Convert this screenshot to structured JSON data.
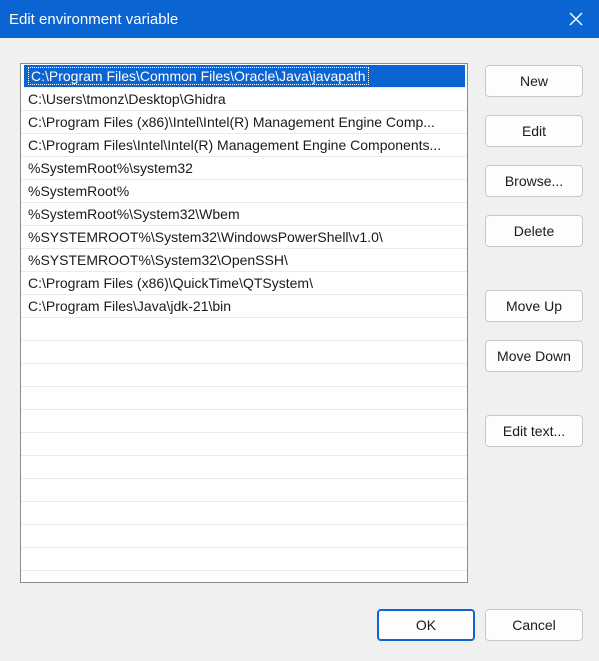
{
  "window": {
    "title": "Edit environment variable",
    "close_icon": "close-icon"
  },
  "paths": [
    "C:\\Program Files\\Common Files\\Oracle\\Java\\javapath",
    "C:\\Users\\tmonz\\Desktop\\Ghidra",
    "C:\\Program Files (x86)\\Intel\\Intel(R) Management Engine Comp...",
    "C:\\Program Files\\Intel\\Intel(R) Management Engine Components...",
    "%SystemRoot%\\system32",
    "%SystemRoot%",
    "%SystemRoot%\\System32\\Wbem",
    "%SYSTEMROOT%\\System32\\WindowsPowerShell\\v1.0\\",
    "%SYSTEMROOT%\\System32\\OpenSSH\\",
    "C:\\Program Files (x86)\\QuickTime\\QTSystem\\",
    "C:\\Program Files\\Java\\jdk-21\\bin"
  ],
  "selected_index": 0,
  "buttons": {
    "new": "New",
    "edit": "Edit",
    "browse": "Browse...",
    "delete": "Delete",
    "move_up": "Move Up",
    "move_down": "Move Down",
    "edit_text": "Edit text...",
    "ok": "OK",
    "cancel": "Cancel"
  },
  "colors": {
    "accent": "#0a64d2",
    "background": "#f0f0f0"
  }
}
